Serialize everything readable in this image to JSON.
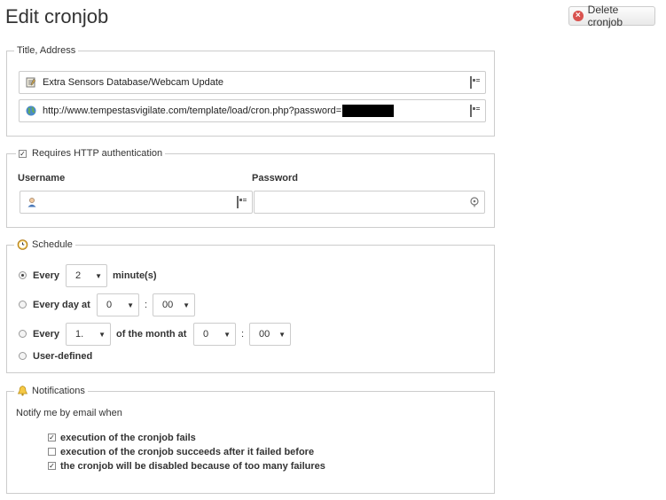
{
  "page": {
    "title": "Edit cronjob",
    "delete_label": "Delete cronjob"
  },
  "title_address": {
    "legend": "Title, Address",
    "title_value": "Extra Sensors Database/Webcam Update",
    "url_value": "http://www.tempestasvigilate.com/template/load/cron.php?password="
  },
  "auth": {
    "legend": "Requires HTTP authentication",
    "checked": true,
    "username_label": "Username",
    "password_label": "Password",
    "username_value": "",
    "password_value": ""
  },
  "schedule": {
    "legend": "Schedule",
    "every_label": "Every",
    "every_value": "2",
    "minutes_label": "minute(s)",
    "every_day_label": "Every day at",
    "day_hour": "0",
    "day_minute": "00",
    "colon": ":",
    "every_month_label": "Every",
    "month_day": "1.",
    "of_month_label": "of the month at",
    "month_hour": "0",
    "month_minute": "00",
    "user_defined_label": "User-defined",
    "selected": "every"
  },
  "notifications": {
    "legend": "Notifications",
    "intro": "Notify me by email when",
    "options": [
      {
        "label": "execution of the cronjob fails",
        "checked": true
      },
      {
        "label": "execution of the cronjob succeeds after it failed before",
        "checked": false
      },
      {
        "label": "the cronjob will be disabled because of too many failures",
        "checked": true
      }
    ]
  }
}
